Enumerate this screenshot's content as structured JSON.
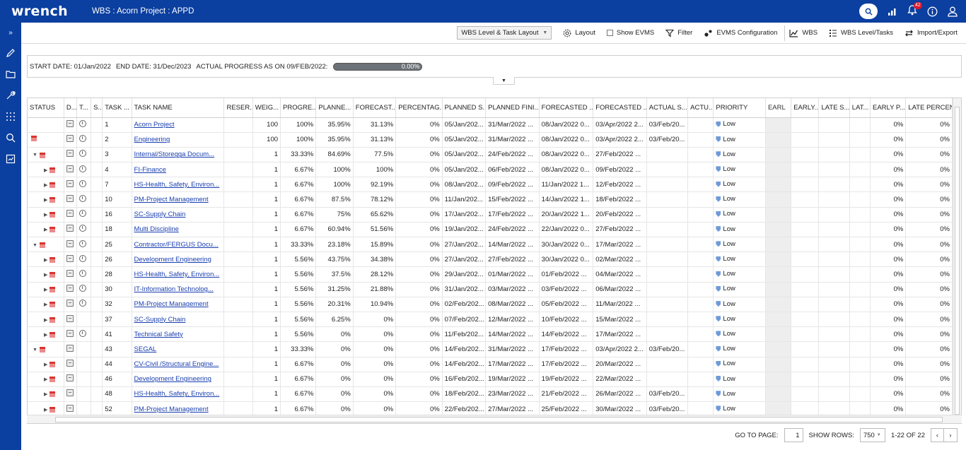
{
  "app": {
    "logo": "wrench",
    "title": "WBS : Acorn Project : APPD",
    "notifications_count": "42"
  },
  "toolbar": {
    "layout_select": "WBS Level & Task Layout",
    "layout": "Layout",
    "show_evms": "Show EVMS",
    "filter": "Filter",
    "evms_config": "EVMS Configuration",
    "wbs": "WBS",
    "wbs_level_tasks": "WBS Level/Tasks",
    "import_export": "Import/Export"
  },
  "info": {
    "start": "START DATE: 01/Jan/2022",
    "end": "END DATE: 31/Dec/2023",
    "progress_label": "ACTUAL PROGRESS AS ON 09/FEB/2022:",
    "progress_value": "0.00%",
    "progress_fraction": 0
  },
  "columns": [
    "STATUS",
    "D...",
    "T...",
    "S...",
    "TASK ...",
    "TASK NAME",
    "RESER...",
    "WEIG...",
    "PROGRE...",
    "PLANNE...",
    "FORECAST...",
    "PERCENTAG...",
    "PLANNED S...",
    "PLANNED FINI...",
    "FORECASTED ...",
    "FORECASTED ...",
    "ACTUAL S...",
    "ACTU...",
    "PRIORITY",
    "EARL",
    "EARLY...",
    "LATE S...",
    "LAT...",
    "EARLY P...",
    "LATE PERCEN..."
  ],
  "rows": [
    {
      "status": "",
      "clock": true,
      "id": "1",
      "name": "Acorn Project",
      "weight": "100",
      "progress": "100%",
      "planned": "35.95%",
      "forecast": "31.13%",
      "percent": "0%",
      "ps": "05/Jan/202...",
      "pf": "31/Mar/2022 ...",
      "fs": "08/Jan/2022 0...",
      "ff": "03/Apr/2022 2...",
      "as": "03/Feb/20...",
      "priority": "Low",
      "ep": "0%",
      "lp": "0%"
    },
    {
      "status": "flag",
      "clock": true,
      "id": "2",
      "name": "Engineering",
      "weight": "100",
      "progress": "100%",
      "planned": "35.95%",
      "forecast": "31.13%",
      "percent": "0%",
      "ps": "05/Jan/202...",
      "pf": "31/Mar/2022 ...",
      "fs": "08/Jan/2022 0...",
      "ff": "03/Apr/2022 2...",
      "as": "03/Feb/20...",
      "priority": "Low",
      "ep": "0%",
      "lp": "0%"
    },
    {
      "status": "down",
      "clock": true,
      "id": "3",
      "name": "Internal/Storegga Docum...",
      "weight": "1",
      "progress": "33.33%",
      "planned": "84.69%",
      "forecast": "77.5%",
      "percent": "0%",
      "ps": "05/Jan/202...",
      "pf": "24/Feb/2022 ...",
      "fs": "08/Jan/2022 0...",
      "ff": "27/Feb/2022 ...",
      "as": "",
      "priority": "Low",
      "ep": "0%",
      "lp": "0%"
    },
    {
      "status": "right",
      "clock": true,
      "id": "4",
      "name": "FI-Finance",
      "weight": "1",
      "progress": "6.67%",
      "planned": "100%",
      "forecast": "100%",
      "percent": "0%",
      "ps": "05/Jan/202...",
      "pf": "06/Feb/2022 ...",
      "fs": "08/Jan/2022 0...",
      "ff": "09/Feb/2022 ...",
      "as": "",
      "priority": "Low",
      "ep": "0%",
      "lp": "0%"
    },
    {
      "status": "right",
      "clock": true,
      "id": "7",
      "name": "HS-Health, Safety, Environ...",
      "weight": "1",
      "progress": "6.67%",
      "planned": "100%",
      "forecast": "92.19%",
      "percent": "0%",
      "ps": "08/Jan/202...",
      "pf": "09/Feb/2022 ...",
      "fs": "11/Jan/2022 1...",
      "ff": "12/Feb/2022 ...",
      "as": "",
      "priority": "Low",
      "ep": "0%",
      "lp": "0%"
    },
    {
      "status": "right",
      "clock": true,
      "id": "10",
      "name": "PM-Project Management",
      "weight": "1",
      "progress": "6.67%",
      "planned": "87.5%",
      "forecast": "78.12%",
      "percent": "0%",
      "ps": "11/Jan/202...",
      "pf": "15/Feb/2022 ...",
      "fs": "14/Jan/2022 1...",
      "ff": "18/Feb/2022 ...",
      "as": "",
      "priority": "Low",
      "ep": "0%",
      "lp": "0%"
    },
    {
      "status": "right",
      "clock": true,
      "id": "16",
      "name": "SC-Supply Chain",
      "weight": "1",
      "progress": "6.67%",
      "planned": "75%",
      "forecast": "65.62%",
      "percent": "0%",
      "ps": "17/Jan/202...",
      "pf": "17/Feb/2022 ...",
      "fs": "20/Jan/2022 1...",
      "ff": "20/Feb/2022 ...",
      "as": "",
      "priority": "Low",
      "ep": "0%",
      "lp": "0%"
    },
    {
      "status": "right",
      "clock": true,
      "id": "18",
      "name": "Multi Discipline",
      "weight": "1",
      "progress": "6.67%",
      "planned": "60.94%",
      "forecast": "51.56%",
      "percent": "0%",
      "ps": "19/Jan/202...",
      "pf": "24/Feb/2022 ...",
      "fs": "22/Jan/2022 0...",
      "ff": "27/Feb/2022 ...",
      "as": "",
      "priority": "Low",
      "ep": "0%",
      "lp": "0%"
    },
    {
      "status": "down",
      "clock": true,
      "id": "25",
      "name": "Contractor/FERGUS Docu...",
      "weight": "1",
      "progress": "33.33%",
      "planned": "23.18%",
      "forecast": "15.89%",
      "percent": "0%",
      "ps": "27/Jan/202...",
      "pf": "14/Mar/2022 ...",
      "fs": "30/Jan/2022 0...",
      "ff": "17/Mar/2022 ...",
      "as": "",
      "priority": "Low",
      "ep": "0%",
      "lp": "0%"
    },
    {
      "status": "right",
      "clock": true,
      "id": "26",
      "name": "Development Engineering",
      "weight": "1",
      "progress": "5.56%",
      "planned": "43.75%",
      "forecast": "34.38%",
      "percent": "0%",
      "ps": "27/Jan/202...",
      "pf": "27/Feb/2022 ...",
      "fs": "30/Jan/2022 0...",
      "ff": "02/Mar/2022 ...",
      "as": "",
      "priority": "Low",
      "ep": "0%",
      "lp": "0%"
    },
    {
      "status": "right",
      "clock": true,
      "id": "28",
      "name": "HS-Health, Safety, Environ...",
      "weight": "1",
      "progress": "5.56%",
      "planned": "37.5%",
      "forecast": "28.12%",
      "percent": "0%",
      "ps": "29/Jan/202...",
      "pf": "01/Mar/2022 ...",
      "fs": "01/Feb/2022 ...",
      "ff": "04/Mar/2022 ...",
      "as": "",
      "priority": "Low",
      "ep": "0%",
      "lp": "0%"
    },
    {
      "status": "right",
      "clock": true,
      "id": "30",
      "name": "IT-Information Technolog...",
      "weight": "1",
      "progress": "5.56%",
      "planned": "31.25%",
      "forecast": "21.88%",
      "percent": "0%",
      "ps": "31/Jan/202...",
      "pf": "03/Mar/2022 ...",
      "fs": "03/Feb/2022 ...",
      "ff": "06/Mar/2022 ...",
      "as": "",
      "priority": "Low",
      "ep": "0%",
      "lp": "0%"
    },
    {
      "status": "right",
      "clock": true,
      "id": "32",
      "name": "PM-Project Management",
      "weight": "1",
      "progress": "5.56%",
      "planned": "20.31%",
      "forecast": "10.94%",
      "percent": "0%",
      "ps": "02/Feb/202...",
      "pf": "08/Mar/2022 ...",
      "fs": "05/Feb/2022 ...",
      "ff": "11/Mar/2022 ...",
      "as": "",
      "priority": "Low",
      "ep": "0%",
      "lp": "0%"
    },
    {
      "status": "right",
      "clock": false,
      "id": "37",
      "name": "SC-Supply Chain",
      "weight": "1",
      "progress": "5.56%",
      "planned": "6.25%",
      "forecast": "0%",
      "percent": "0%",
      "ps": "07/Feb/202...",
      "pf": "12/Mar/2022 ...",
      "fs": "10/Feb/2022 ...",
      "ff": "15/Mar/2022 ...",
      "as": "",
      "priority": "Low",
      "ep": "0%",
      "lp": "0%"
    },
    {
      "status": "right",
      "clock": true,
      "id": "41",
      "name": "Technical Safety",
      "weight": "1",
      "progress": "5.56%",
      "planned": "0%",
      "forecast": "0%",
      "percent": "0%",
      "ps": "11/Feb/202...",
      "pf": "14/Mar/2022 ...",
      "fs": "14/Feb/2022 ...",
      "ff": "17/Mar/2022 ...",
      "as": "",
      "priority": "Low",
      "ep": "0%",
      "lp": "0%"
    },
    {
      "status": "down",
      "clock": false,
      "id": "43",
      "name": "SEGAL",
      "weight": "1",
      "progress": "33.33%",
      "planned": "0%",
      "forecast": "0%",
      "percent": "0%",
      "ps": "14/Feb/202...",
      "pf": "31/Mar/2022 ...",
      "fs": "17/Feb/2022 ...",
      "ff": "03/Apr/2022 2...",
      "as": "03/Feb/20...",
      "priority": "Low",
      "ep": "0%",
      "lp": "0%"
    },
    {
      "status": "right",
      "clock": false,
      "id": "44",
      "name": "CV-Civil /Structural Engine...",
      "weight": "1",
      "progress": "6.67%",
      "planned": "0%",
      "forecast": "0%",
      "percent": "0%",
      "ps": "14/Feb/202...",
      "pf": "17/Mar/2022 ...",
      "fs": "17/Feb/2022 ...",
      "ff": "20/Mar/2022 ...",
      "as": "",
      "priority": "Low",
      "ep": "0%",
      "lp": "0%"
    },
    {
      "status": "right",
      "clock": false,
      "id": "46",
      "name": "Development Engineering",
      "weight": "1",
      "progress": "6.67%",
      "planned": "0%",
      "forecast": "0%",
      "percent": "0%",
      "ps": "16/Feb/202...",
      "pf": "19/Mar/2022 ...",
      "fs": "19/Feb/2022 ...",
      "ff": "22/Mar/2022 ...",
      "as": "",
      "priority": "Low",
      "ep": "0%",
      "lp": "0%"
    },
    {
      "status": "right",
      "clock": false,
      "id": "48",
      "name": "HS-Health, Safety, Environ...",
      "weight": "1",
      "progress": "6.67%",
      "planned": "0%",
      "forecast": "0%",
      "percent": "0%",
      "ps": "18/Feb/202...",
      "pf": "23/Mar/2022 ...",
      "fs": "21/Feb/2022 ...",
      "ff": "26/Mar/2022 ...",
      "as": "03/Feb/20...",
      "priority": "Low",
      "ep": "0%",
      "lp": "0%"
    },
    {
      "status": "right",
      "clock": false,
      "id": "52",
      "name": "PM-Project Management",
      "weight": "1",
      "progress": "6.67%",
      "planned": "0%",
      "forecast": "0%",
      "percent": "0%",
      "ps": "22/Feb/202...",
      "pf": "27/Mar/2022 ...",
      "fs": "25/Feb/2022 ...",
      "ff": "30/Mar/2022 ...",
      "as": "03/Feb/20...",
      "priority": "Low",
      "ep": "0%",
      "lp": "0%"
    }
  ],
  "pager": {
    "goto_label": "GO TO PAGE:",
    "page": "1",
    "show_rows_label": "SHOW ROWS:",
    "rows_value": "750",
    "range": "1-22 OF 22"
  }
}
